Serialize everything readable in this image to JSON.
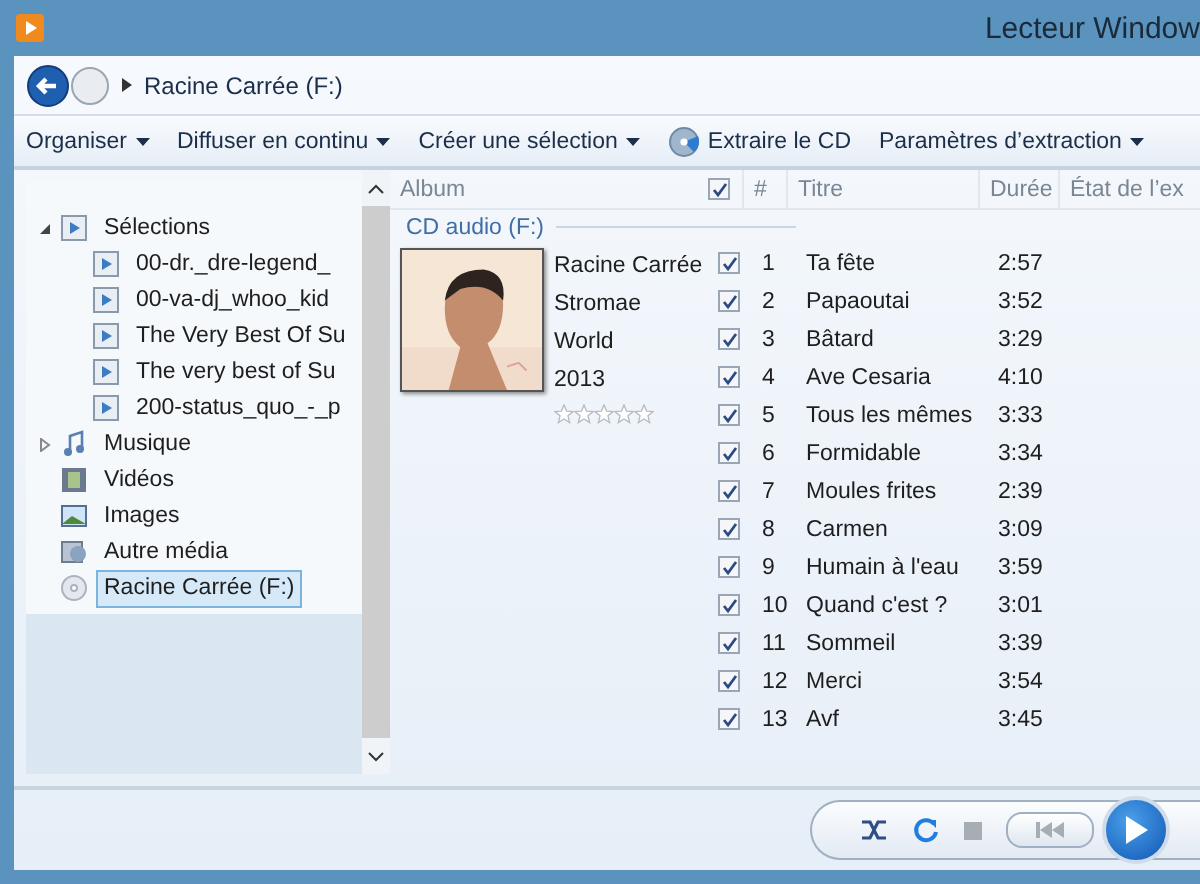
{
  "window": {
    "title": "Lecteur Window"
  },
  "breadcrumb": {
    "location": "Racine Carrée (F:)"
  },
  "toolbar": [
    {
      "label": "Organiser",
      "kind": "menu"
    },
    {
      "label": "Diffuser en continu",
      "kind": "menu"
    },
    {
      "label": "Créer une sélection",
      "kind": "menu"
    },
    {
      "label": "Extraire le CD",
      "kind": "action"
    },
    {
      "label": "Paramètres d’extraction",
      "kind": "menu"
    }
  ],
  "sidebar": {
    "items": [
      {
        "label": "Sélections",
        "kind": "playlists",
        "expanded": true,
        "selected": false,
        "children": [
          {
            "label": "00-dr._dre-legend_",
            "kind": "playlist",
            "selected": false
          },
          {
            "label": "00-va-dj_whoo_kid",
            "kind": "playlist",
            "selected": false
          },
          {
            "label": "The Very Best Of Su",
            "kind": "playlist",
            "selected": false
          },
          {
            "label": "The very best of Su",
            "kind": "playlist",
            "selected": false
          },
          {
            "label": "200-status_quo_-_p",
            "kind": "playlist",
            "selected": false
          }
        ]
      },
      {
        "label": "Musique",
        "kind": "music",
        "expanded": false,
        "selected": false
      },
      {
        "label": "Vidéos",
        "kind": "video",
        "selected": false
      },
      {
        "label": "Images",
        "kind": "images",
        "selected": false
      },
      {
        "label": "Autre média",
        "kind": "other",
        "selected": false
      },
      {
        "label": "Racine Carrée (F:)",
        "kind": "cd",
        "selected": true
      }
    ]
  },
  "table": {
    "columns": [
      "Album",
      "#",
      "Titre",
      "Durée",
      "État de l’ex"
    ],
    "all_checked": true,
    "group": "CD audio (F:)",
    "album": {
      "kind": "picture",
      "title": "Racine Carrée",
      "artist": "Stromae",
      "genre": "World",
      "year": "2013",
      "stars": 0
    },
    "rows": [
      {
        "checked": true,
        "number": "1",
        "title": "Ta fête",
        "duration": "2:57"
      },
      {
        "checked": true,
        "number": "2",
        "title": "Papaoutai",
        "duration": "3:52"
      },
      {
        "checked": true,
        "number": "3",
        "title": "Bâtard",
        "duration": "3:29"
      },
      {
        "checked": true,
        "number": "4",
        "title": "Ave Cesaria",
        "duration": "4:10"
      },
      {
        "checked": true,
        "number": "5",
        "title": "Tous les mêmes",
        "duration": "3:33"
      },
      {
        "checked": true,
        "number": "6",
        "title": "Formidable",
        "duration": "3:34"
      },
      {
        "checked": true,
        "number": "7",
        "title": "Moules frites",
        "duration": "2:39"
      },
      {
        "checked": true,
        "number": "8",
        "title": "Carmen",
        "duration": "3:09"
      },
      {
        "checked": true,
        "number": "9",
        "title": "Humain à l'eau",
        "duration": "3:59"
      },
      {
        "checked": true,
        "number": "10",
        "title": "Quand c'est ?",
        "duration": "3:01"
      },
      {
        "checked": true,
        "number": "11",
        "title": "Sommeil",
        "duration": "3:39"
      },
      {
        "checked": true,
        "number": "12",
        "title": "Merci",
        "duration": "3:54"
      },
      {
        "checked": true,
        "number": "13",
        "title": "Avf",
        "duration": "3:45"
      }
    ]
  },
  "player": {
    "shuffle": false,
    "repeat": true
  }
}
